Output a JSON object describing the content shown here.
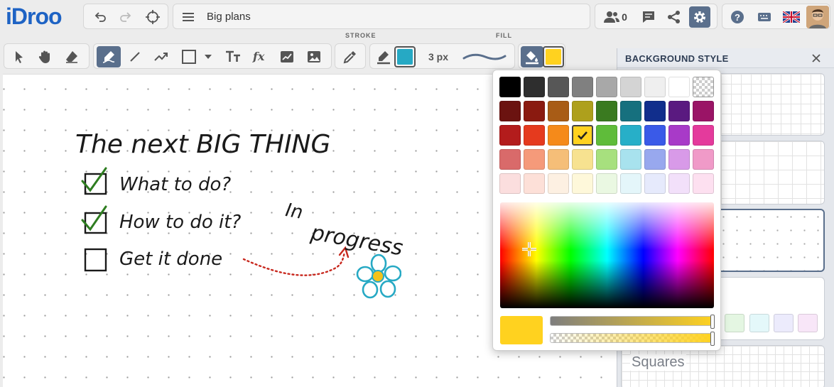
{
  "app": {
    "logo": "iDroo"
  },
  "board": {
    "title": "Big plans",
    "users_count": "0"
  },
  "toolbar": {
    "stroke_caption": "STROKE",
    "fill_caption": "FILL",
    "stroke_width": "3 px"
  },
  "panel": {
    "title": "BACKGROUND STYLE",
    "squares_label": "Squares"
  },
  "canvas": {
    "heading": "The next BIG THING",
    "tasks": [
      {
        "label": "What to do?",
        "checked": true
      },
      {
        "label": "How to do it?",
        "checked": true
      },
      {
        "label": "Get it done",
        "checked": false
      }
    ],
    "note": {
      "line1": "In",
      "line2": "progress"
    }
  },
  "colors": {
    "accent": "#5a6f8c",
    "stroke_color": "#26a9c4",
    "fill_color": "#ffd21f",
    "palette": [
      [
        "#000000",
        "#2e2e2e",
        "#575757",
        "#808080",
        "#a8a8a8",
        "#d4d4d4",
        "#efefef",
        "#ffffff",
        "transparent"
      ],
      [
        "#6b1310",
        "#8a1a10",
        "#a85c16",
        "#aea01c",
        "#3a7a20",
        "#16707e",
        "#112e8c",
        "#5a1a80",
        "#9a1466"
      ],
      [
        "#b31c1c",
        "#e53a1e",
        "#f58a1a",
        "#ffd21f",
        "#5fbc3a",
        "#27afc8",
        "#3a5ae8",
        "#a83ac8",
        "#e43a9c"
      ],
      [
        "#d96a6a",
        "#f59a7a",
        "#f5be78",
        "#f7e290",
        "#a7e07e",
        "#a8e2ee",
        "#98a8ee",
        "#d89ae8",
        "#f09ac8"
      ],
      [
        "#fbdede",
        "#fde0d8",
        "#fdf0e2",
        "#fef8da",
        "#eaf8e2",
        "#e4f6fa",
        "#e6eafc",
        "#f2e0fa",
        "#fde0f0"
      ]
    ],
    "selected": "#ffd21f",
    "panel_swatches": [
      "#e4f6e2",
      "#e4f8fa",
      "#ecebfc",
      "#f8e6f8"
    ]
  },
  "icons": [
    "undo-icon",
    "redo-icon",
    "target-icon",
    "menu-icon",
    "users-icon",
    "chat-icon",
    "share-icon",
    "gear-icon",
    "help-icon",
    "keyboard-icon",
    "uk-flag-icon",
    "select-icon",
    "hand-icon",
    "eraser-icon",
    "pen-icon",
    "line-icon",
    "arrow-icon",
    "rectangle-icon",
    "text-icon",
    "formula-icon",
    "chart-icon",
    "image-icon",
    "eyedropper-icon",
    "stroke-color-icon",
    "fill-bucket-icon",
    "close-icon"
  ]
}
